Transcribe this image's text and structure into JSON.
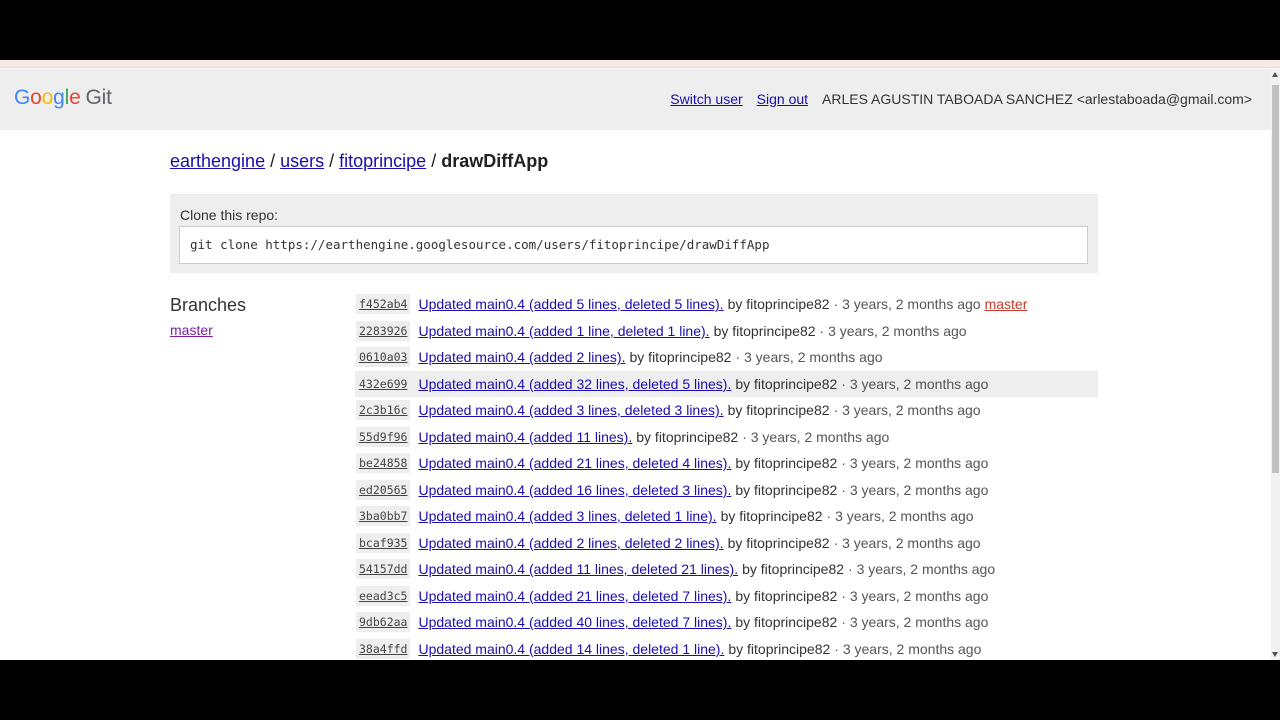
{
  "header": {
    "logo_parts": [
      "G",
      "o",
      "o",
      "g",
      "l",
      "e"
    ],
    "logo_suffix": "Git",
    "switch_user": "Switch user",
    "sign_out": "Sign out",
    "account": "ARLES AGUSTIN TABOADA SANCHEZ <arlestaboada@gmail.com>"
  },
  "breadcrumb": {
    "items": [
      "earthengine",
      "users",
      "fitoprincipe"
    ],
    "separator": "/",
    "current": "drawDiffApp"
  },
  "clone": {
    "label": "Clone this repo:",
    "command": "git clone https://earthengine.googlesource.com/users/fitoprincipe/drawDiffApp"
  },
  "branches": {
    "title": "Branches",
    "items": [
      "master"
    ]
  },
  "log": [
    {
      "sha": "f452ab4",
      "msg": "Updated main0.4 (added 5 lines, deleted 5 lines).",
      "author": "by fitoprincipe82",
      "time": "· 3 years, 2 months ago",
      "ref": "master"
    },
    {
      "sha": "2283926",
      "msg": "Updated main0.4 (added 1 line, deleted 1 line).",
      "author": "by fitoprincipe82",
      "time": "· 3 years, 2 months ago"
    },
    {
      "sha": "0610a03",
      "msg": "Updated main0.4 (added 2 lines).",
      "author": "by fitoprincipe82",
      "time": "· 3 years, 2 months ago"
    },
    {
      "sha": "432e699",
      "msg": "Updated main0.4 (added 32 lines, deleted 5 lines).",
      "author": "by fitoprincipe82",
      "time": "· 3 years, 2 months ago",
      "highlighted": true
    },
    {
      "sha": "2c3b16c",
      "msg": "Updated main0.4 (added 3 lines, deleted 3 lines).",
      "author": "by fitoprincipe82",
      "time": "· 3 years, 2 months ago"
    },
    {
      "sha": "55d9f96",
      "msg": "Updated main0.4 (added 11 lines).",
      "author": "by fitoprincipe82",
      "time": "· 3 years, 2 months ago"
    },
    {
      "sha": "be24858",
      "msg": "Updated main0.4 (added 21 lines, deleted 4 lines).",
      "author": "by fitoprincipe82",
      "time": "· 3 years, 2 months ago"
    },
    {
      "sha": "ed20565",
      "msg": "Updated main0.4 (added 16 lines, deleted 3 lines).",
      "author": "by fitoprincipe82",
      "time": "· 3 years, 2 months ago"
    },
    {
      "sha": "3ba0bb7",
      "msg": "Updated main0.4 (added 3 lines, deleted 1 line).",
      "author": "by fitoprincipe82",
      "time": "· 3 years, 2 months ago"
    },
    {
      "sha": "bcaf935",
      "msg": "Updated main0.4 (added 2 lines, deleted 2 lines).",
      "author": "by fitoprincipe82",
      "time": "· 3 years, 2 months ago"
    },
    {
      "sha": "54157dd",
      "msg": "Updated main0.4 (added 11 lines, deleted 21 lines).",
      "author": "by fitoprincipe82",
      "time": "· 3 years, 2 months ago"
    },
    {
      "sha": "eead3c5",
      "msg": "Updated main0.4 (added 21 lines, deleted 7 lines).",
      "author": "by fitoprincipe82",
      "time": "· 3 years, 2 months ago"
    },
    {
      "sha": "9db62aa",
      "msg": "Updated main0.4 (added 40 lines, deleted 7 lines).",
      "author": "by fitoprincipe82",
      "time": "· 3 years, 2 months ago"
    },
    {
      "sha": "38a4ffd",
      "msg": "Updated main0.4 (added 14 lines, deleted 1 line).",
      "author": "by fitoprincipe82",
      "time": "· 3 years, 2 months ago"
    }
  ]
}
